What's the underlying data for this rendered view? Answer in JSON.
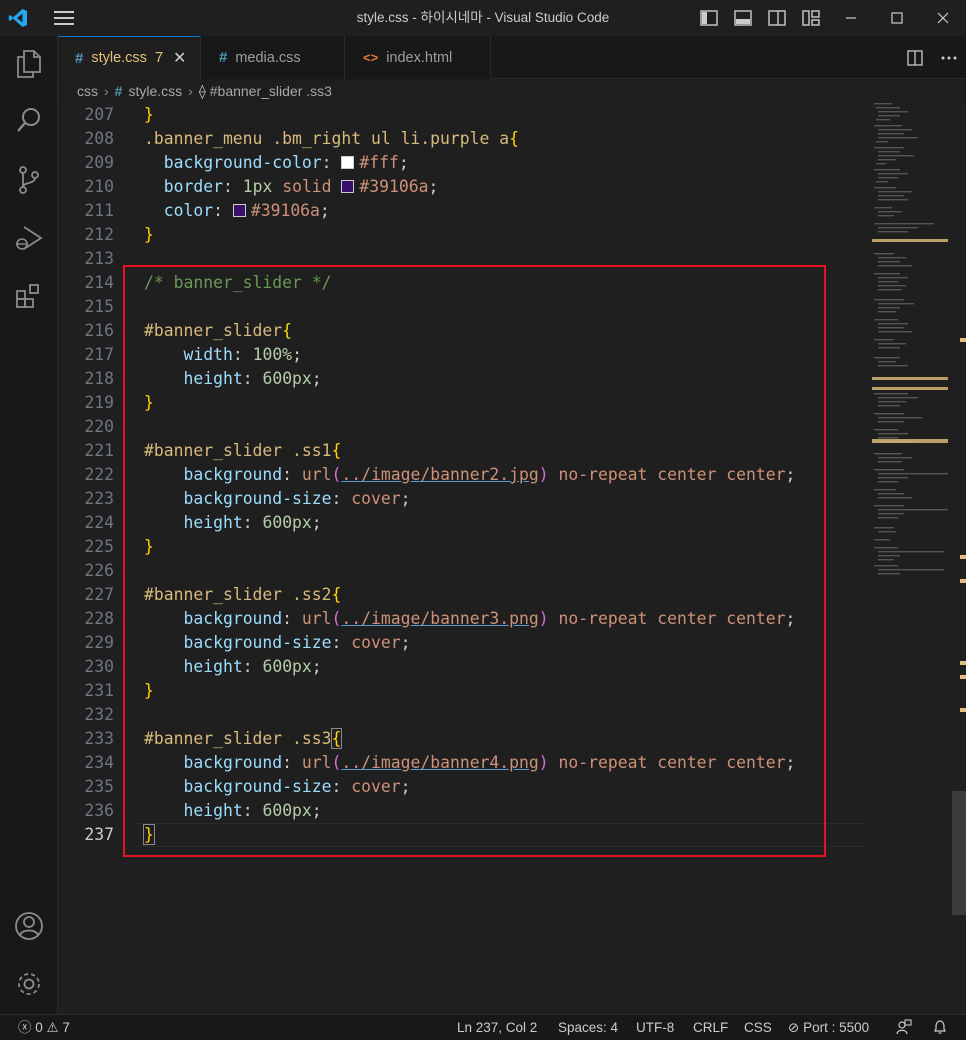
{
  "window": {
    "title": "style.css - 하이시네마 - Visual Studio Code"
  },
  "tabs": [
    {
      "label": "style.css",
      "icon": "#",
      "problems": "7",
      "active": true
    },
    {
      "label": "media.css",
      "icon": "#",
      "active": false
    },
    {
      "label": "index.html",
      "icon": "<>",
      "active": false
    }
  ],
  "breadcrumb": {
    "folder": "css",
    "file": "style.css",
    "symbol": "#banner_slider .ss3"
  },
  "editor": {
    "line_numbers": [
      "207",
      "208",
      "209",
      "210",
      "211",
      "212",
      "213",
      "214",
      "215",
      "216",
      "217",
      "218",
      "219",
      "220",
      "221",
      "222",
      "223",
      "224",
      "225",
      "226",
      "227",
      "228",
      "229",
      "230",
      "231",
      "232",
      "233",
      "234",
      "235",
      "236",
      "237"
    ],
    "current_line": "237",
    "lines": {
      "l207_brace": "}",
      "l208_sel": ".banner_menu .bm_right ul li.purple a",
      "l208_brace": "{",
      "l209_prop": "background-color",
      "l209_val": "#fff",
      "l210_prop": "border",
      "l210_num": "1px",
      "l210_kw": "solid",
      "l210_val": "#39106a",
      "l211_prop": "color",
      "l211_val": "#39106a",
      "l212_brace": "}",
      "l214_cmt": "/* banner_slider */",
      "l216_sel": "#banner_slider",
      "l217_prop": "width",
      "l217_num": "100%",
      "l218_prop": "height",
      "l218_num": "600px",
      "l221_sel": "#banner_slider .ss1",
      "l222_prop": "background",
      "l222_fn": "url",
      "l222_url": "../image/banner2.jpg",
      "l222_rest": "no-repeat center center",
      "l223_prop": "background-size",
      "l223_val": "cover",
      "l224_prop": "height",
      "l224_num": "600px",
      "l227_sel": "#banner_slider .ss2",
      "l228_prop": "background",
      "l228_fn": "url",
      "l228_url": "../image/banner3.png",
      "l228_rest": "no-repeat center center",
      "l229_prop": "background-size",
      "l229_val": "cover",
      "l230_prop": "height",
      "l230_num": "600px",
      "l233_sel": "#banner_slider .ss3",
      "l234_prop": "background",
      "l234_fn": "url",
      "l234_url": "../image/banner4.png",
      "l234_rest": "no-repeat center center",
      "l235_prop": "background-size",
      "l235_val": "cover",
      "l236_prop": "height",
      "l236_num": "600px"
    },
    "colors": {
      "swatch_white": "#ffffff",
      "swatch_purple": "#39106a",
      "highlight": "#e81123"
    }
  },
  "statusbar": {
    "errors": "0",
    "warnings": "7",
    "position": "Ln 237, Col 2",
    "spaces": "Spaces: 4",
    "encoding": "UTF-8",
    "eol": "CRLF",
    "language": "CSS",
    "port": "Port : 5500"
  }
}
